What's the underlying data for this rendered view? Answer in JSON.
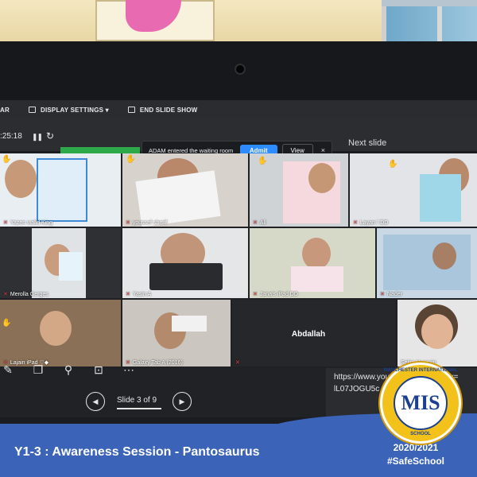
{
  "toolbar": {
    "partial_left": "AR",
    "display_settings": "DISPLAY SETTINGS ▾",
    "end_slide_show": "END SLIDE SHOW"
  },
  "presenter": {
    "timer": ":25:18",
    "next_slide": "Next slide"
  },
  "notification": {
    "message": "ADAM entered the waiting room",
    "admit": "Admit",
    "view": "View",
    "close": "×"
  },
  "participants": [
    {
      "name": "Yazen walid King"
    },
    {
      "name": "youssef sherif"
    },
    {
      "name": "Ali"
    },
    {
      "name": "Layan♡DD"
    },
    {
      "name": "Merolla Gerges"
    },
    {
      "name": "Yasin A"
    },
    {
      "name": "Jana's iPad DD"
    },
    {
      "name": "Nader"
    },
    {
      "name": "Lajain iPad ♡◆"
    },
    {
      "name": "Galaxy Tab A (2016)"
    },
    {
      "name": "Abdallah"
    },
    {
      "name": "Selim Hussain"
    }
  ],
  "slide_controls": {
    "counter": "Slide 3 of 9",
    "prev": "◀",
    "next": "▶"
  },
  "chat": {
    "line1": "https://www.youtube.com/watch?v=",
    "line2": "lL07JOGU5c"
  },
  "banner": {
    "title": "Y1-3 : Awareness Session - Pantosaurus",
    "year": "2020/2021",
    "hashtag": "#SafeSchool"
  },
  "logo": {
    "letters": "MIS",
    "ring_top": "MANCHESTER INTERNATIONAL",
    "ring_bottom": "SCHOOL"
  },
  "colors": {
    "banner": "#3b63b8",
    "admit": "#2d8cff",
    "badge_gold": "#f2c21b",
    "badge_blue": "#1c3f8f"
  }
}
